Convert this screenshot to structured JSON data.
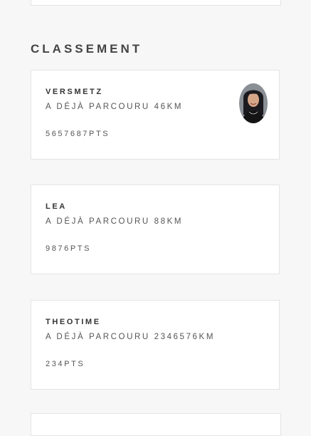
{
  "section": {
    "title": "CLASSEMENT"
  },
  "ranking": [
    {
      "name": "VERSMETZ",
      "distance": "A DÉJÀ PARCOURU 46KM",
      "points": "5657687PTS",
      "has_avatar": true
    },
    {
      "name": "LEA",
      "distance": "A DÉJÀ PARCOURU 88KM",
      "points": "9876PTS",
      "has_avatar": false
    },
    {
      "name": "THEOTIME",
      "distance": "A DÉJÀ PARCOURU 2346576KM",
      "points": "234PTS",
      "has_avatar": false
    }
  ],
  "colors": {
    "background": "#f7f7f7",
    "card": "#ffffff",
    "border": "#e4e4e4",
    "title_text": "#444444",
    "body_text": "#555555"
  }
}
